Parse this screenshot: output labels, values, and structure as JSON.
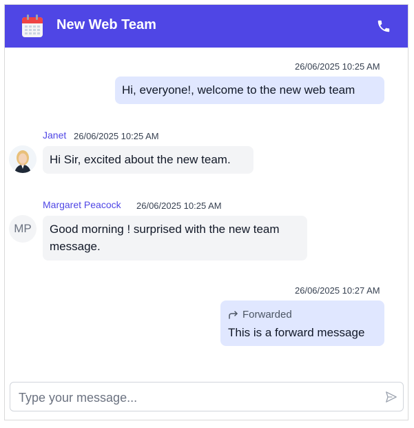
{
  "header": {
    "title": "New Web Team",
    "calendar_icon": "calendar-icon",
    "phone_icon": "phone-icon"
  },
  "messages": [
    {
      "direction": "outgoing",
      "timestamp": "26/06/2025 10:25 AM",
      "text": "Hi, everyone!, welcome to the new web team"
    },
    {
      "direction": "incoming",
      "sender": "Janet",
      "timestamp": "26/06/2025 10:25 AM",
      "text": "Hi Sir, excited about the new team.",
      "avatar": "photo"
    },
    {
      "direction": "incoming",
      "sender": "Margaret Peacock",
      "timestamp": "26/06/2025 10:25 AM",
      "text": "Good morning ! surprised with the new team message.",
      "avatar_initials": "MP"
    },
    {
      "direction": "outgoing",
      "timestamp": "26/06/2025 10:27 AM",
      "forwarded_label": "Forwarded",
      "text": "This is a forward message"
    }
  ],
  "composer": {
    "placeholder": "Type your message...",
    "send_icon": "send-icon"
  },
  "colors": {
    "header_bg": "#4f46e5",
    "outgoing_bubble": "#e0e7ff",
    "incoming_bubble": "#f3f4f6",
    "sender_name": "#4f46e5"
  }
}
